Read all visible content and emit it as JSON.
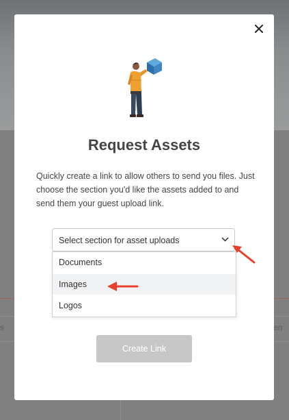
{
  "background": {
    "left_peek_text": "s",
    "right_peek_text": "en"
  },
  "modal": {
    "close_icon": "close-icon",
    "illustration": "person-holding-box-illustration",
    "title": "Request Assets",
    "description": "Quickly create a link to allow others to send you files. Just choose the section you'd like the assets added to and send them your guest upload link.",
    "section_select": {
      "placeholder": "Select section for asset uploads",
      "options": [
        "Documents",
        "Images",
        "Logos"
      ],
      "highlighted": "Images"
    },
    "create_button_label": "Create Link"
  },
  "annotations": {
    "arrow_color": "#e8402a"
  }
}
